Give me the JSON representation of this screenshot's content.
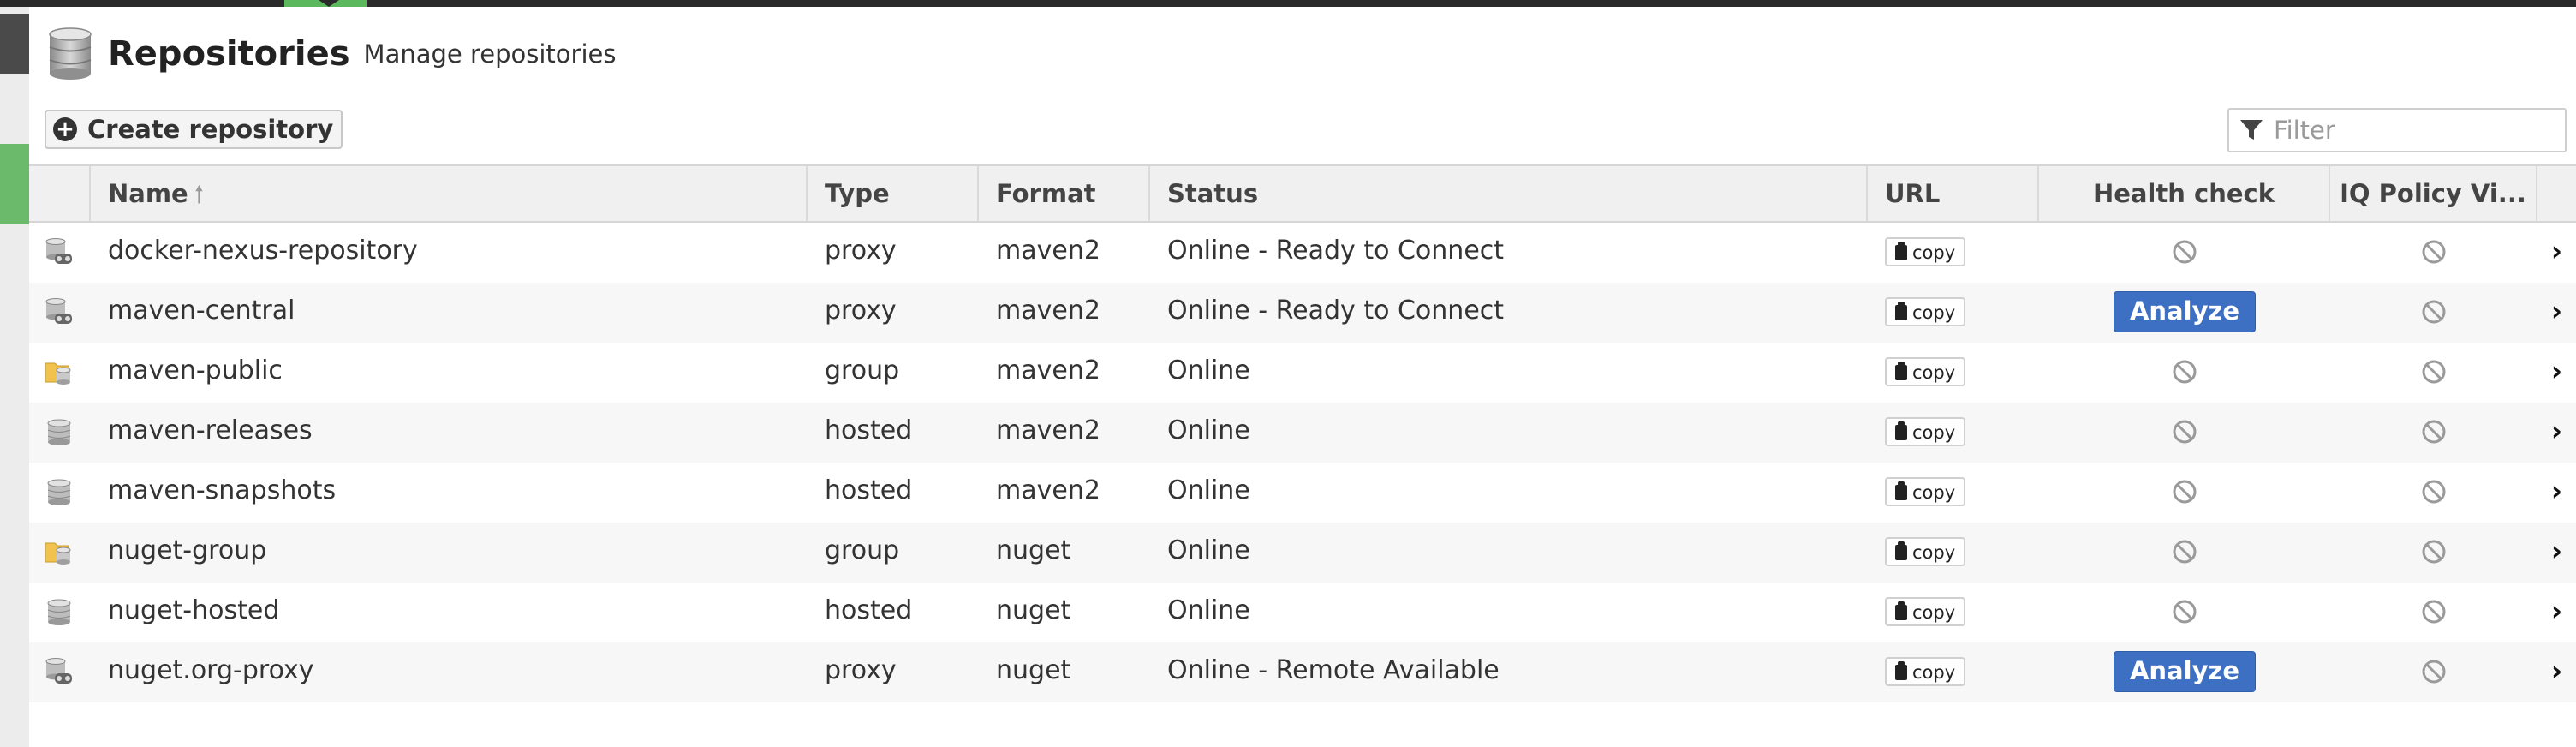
{
  "header": {
    "title": "Repositories",
    "subtitle": "Manage repositories"
  },
  "toolbar": {
    "create_label": "Create repository",
    "filter_placeholder": "Filter"
  },
  "columns": {
    "name": "Name",
    "type": "Type",
    "format": "Format",
    "status": "Status",
    "url": "URL",
    "health": "Health check",
    "iq": "IQ Policy Vi..."
  },
  "sort": {
    "column": "name",
    "direction": "ascending"
  },
  "copy_label": "copy",
  "analyze_label": "Analyze",
  "rows": [
    {
      "icon": "proxy-repo-icon",
      "name": "docker-nexus-repository",
      "type": "proxy",
      "format": "maven2",
      "status": "Online - Ready to Connect",
      "health": "unavailable"
    },
    {
      "icon": "proxy-repo-icon",
      "name": "maven-central",
      "type": "proxy",
      "format": "maven2",
      "status": "Online - Ready to Connect",
      "health": "analyze"
    },
    {
      "icon": "group-repo-icon",
      "name": "maven-public",
      "type": "group",
      "format": "maven2",
      "status": "Online",
      "health": "unavailable"
    },
    {
      "icon": "hosted-repo-icon",
      "name": "maven-releases",
      "type": "hosted",
      "format": "maven2",
      "status": "Online",
      "health": "unavailable"
    },
    {
      "icon": "hosted-repo-icon",
      "name": "maven-snapshots",
      "type": "hosted",
      "format": "maven2",
      "status": "Online",
      "health": "unavailable"
    },
    {
      "icon": "group-repo-icon",
      "name": "nuget-group",
      "type": "group",
      "format": "nuget",
      "status": "Online",
      "health": "unavailable"
    },
    {
      "icon": "hosted-repo-icon",
      "name": "nuget-hosted",
      "type": "hosted",
      "format": "nuget",
      "status": "Online",
      "health": "unavailable"
    },
    {
      "icon": "proxy-repo-icon",
      "name": "nuget.org-proxy",
      "type": "proxy",
      "format": "nuget",
      "status": "Online - Remote Available",
      "health": "analyze"
    }
  ],
  "colors": {
    "analyze_button": "#3d6fc2",
    "nav_accent": "#5cb85c"
  }
}
